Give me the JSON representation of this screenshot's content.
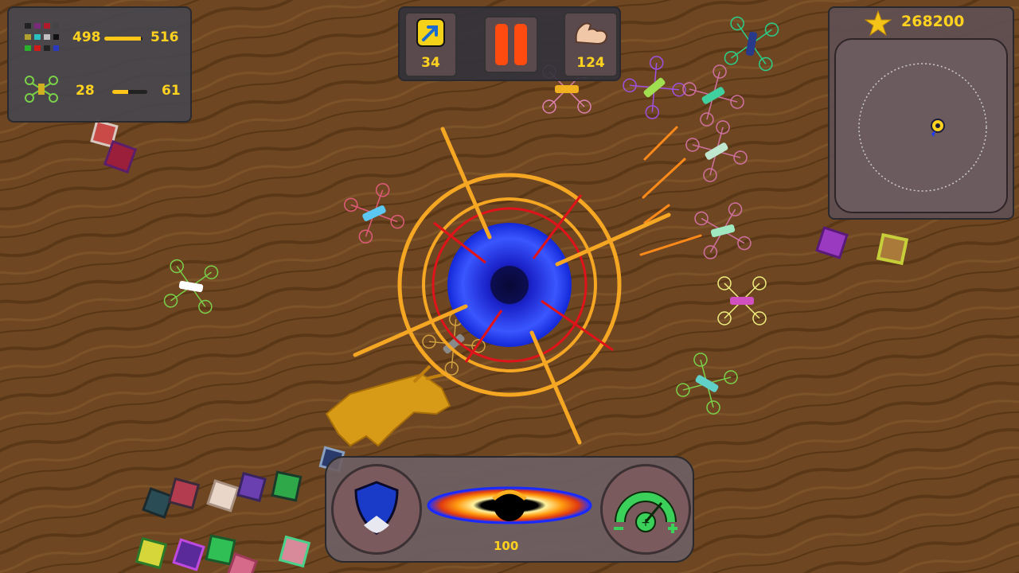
{
  "score": {
    "value": "268200"
  },
  "stats": {
    "cubes": {
      "current": "498",
      "max": "516",
      "fill": 0.965
    },
    "drones": {
      "current": "28",
      "max": "61",
      "fill": 0.46
    }
  },
  "topbar": {
    "exit_count": "34",
    "power_count": "124"
  },
  "bottombar": {
    "blackhole_value": "100"
  },
  "colors": {
    "accent": "#ffd21f",
    "ring": "#f5a623",
    "hole": "#1f3aff",
    "ground": "#6b4520"
  },
  "icons": {
    "exit": "exit-arrow-icon",
    "pause": "pause-icon",
    "power": "flexed-arm-icon",
    "shield": "shield-icon",
    "speed": "speedometer-icon",
    "star": "star-icon"
  }
}
